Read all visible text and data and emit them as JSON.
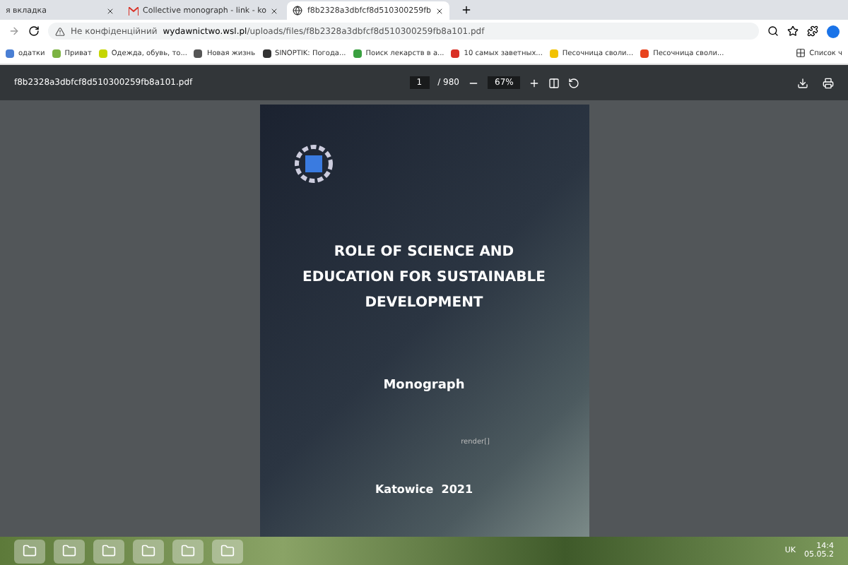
{
  "tabs": [
    {
      "title": "я вкладка",
      "selected": false,
      "kind": "blank"
    },
    {
      "title": "Collective monograph - link - ko",
      "selected": false,
      "kind": "mail"
    },
    {
      "title": "f8b2328a3dbfcf8d510300259fb",
      "selected": true,
      "kind": "web"
    }
  ],
  "address_bar": {
    "security": "Не конфіденційний",
    "host": "wydawnictwo.wsl.pl",
    "path": "/uploads/files/f8b2328a3dbfcf8d510300259fb8a101.pdf"
  },
  "bookmarks": [
    {
      "label": "одатки",
      "color": "#4a7fd4"
    },
    {
      "label": "Приват",
      "color": "#7cb342"
    },
    {
      "label": "Одежда, обувь, то...",
      "color": "#c6d600"
    },
    {
      "label": "Новая жизнь",
      "color": "#555555"
    },
    {
      "label": "SINOPTIK: Погода...",
      "color": "#333333"
    },
    {
      "label": "Поиск лекарств в а...",
      "color": "#3aa040"
    },
    {
      "label": "10 самых заветных...",
      "color": "#d93025"
    },
    {
      "label": "Песочница своли...",
      "color": "#f2c200"
    },
    {
      "label": "Песочница своли...",
      "color": "#e8431d"
    }
  ],
  "reading_list": "Список ч",
  "pdf_toolbar": {
    "filename": "f8b2328a3dbfcf8d510300259fb8a101.pdf",
    "page": "1",
    "page_count": "/ 980",
    "zoom": "67%"
  },
  "cover": {
    "title_lines": [
      "ROLE OF SCIENCE AND",
      "EDUCATION FOR SUSTAINABLE",
      "DEVELOPMENT"
    ],
    "subtitle": "Monograph",
    "tag": "render[]",
    "place": "Katowice  2021"
  },
  "taskbar": {
    "language": "UK",
    "time": "14:4",
    "date": "05.05.2"
  }
}
